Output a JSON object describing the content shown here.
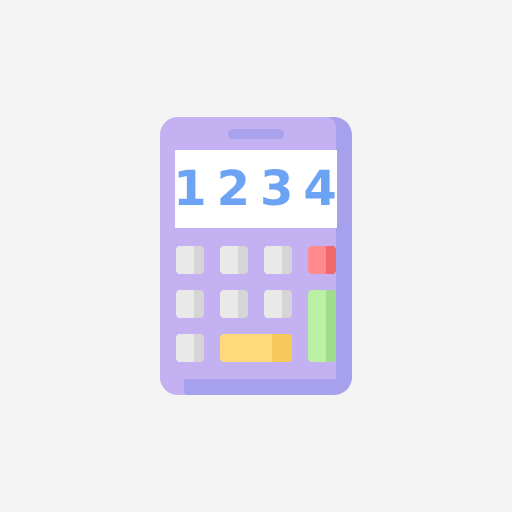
{
  "display": {
    "value": "1234"
  },
  "colors": {
    "background": "#f4f4f4",
    "body": "#c4b1f1",
    "body_shadow": "#a7a0ec",
    "display_text": "#6da3f4",
    "key_gray": "#e9e9ea",
    "key_red": "#ff8b8e",
    "key_green": "#b9f0a3",
    "key_yellow": "#ffd97a"
  },
  "icon": "calculator-icon"
}
